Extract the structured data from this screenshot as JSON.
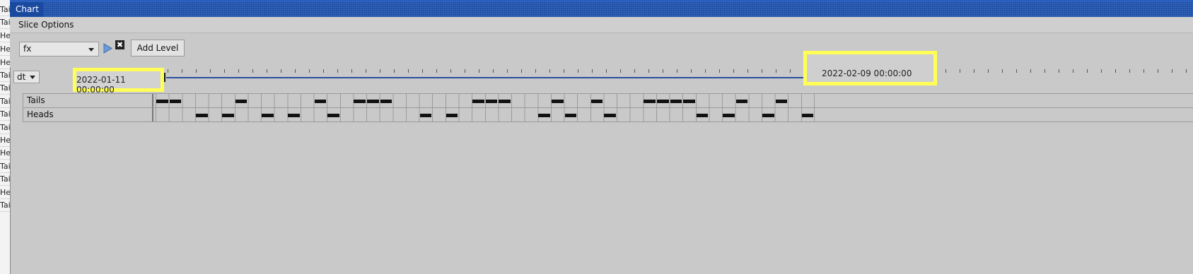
{
  "left_pane": {
    "items": [
      "Tails",
      "Tails",
      "Heads",
      "Heads",
      "Heads",
      "Tails",
      "Tails",
      "Tails",
      "Tails",
      "Tails",
      "Heads",
      "Heads",
      "Tails",
      "Tails",
      "Heads",
      "Tails"
    ]
  },
  "window": {
    "title": "Chart",
    "menu": {
      "slice_options": "Slice Options"
    }
  },
  "toolbar": {
    "field_select": {
      "value": "fx"
    },
    "play_icon": "play-icon",
    "clear_icon": "close-icon",
    "clear_glyph": "✖",
    "add_level_label": "Add Level"
  },
  "timeline": {
    "dimension_select": {
      "value": "dt"
    },
    "start_date": "2022-01-11 00:00:00",
    "end_date": "2022-02-09 00:00:00"
  },
  "grid": {
    "rows": [
      {
        "label": "Tails"
      },
      {
        "label": "Heads"
      }
    ],
    "slots": 50,
    "sequence": [
      "T",
      "T",
      "H",
      "H",
      "T",
      "H",
      "H",
      "T",
      "H",
      "T",
      "T",
      "T",
      "H",
      "H",
      "T",
      "T",
      "T",
      "H",
      "T",
      "H",
      "T",
      "H",
      "T",
      "T",
      "T",
      "T",
      "H",
      "H",
      "T",
      "H",
      "T",
      "H"
    ]
  },
  "colors": {
    "title_bar": "#1a4aa0",
    "range_line": "#2a4fa0",
    "highlight": "#ffff55",
    "bar": "#111111"
  }
}
